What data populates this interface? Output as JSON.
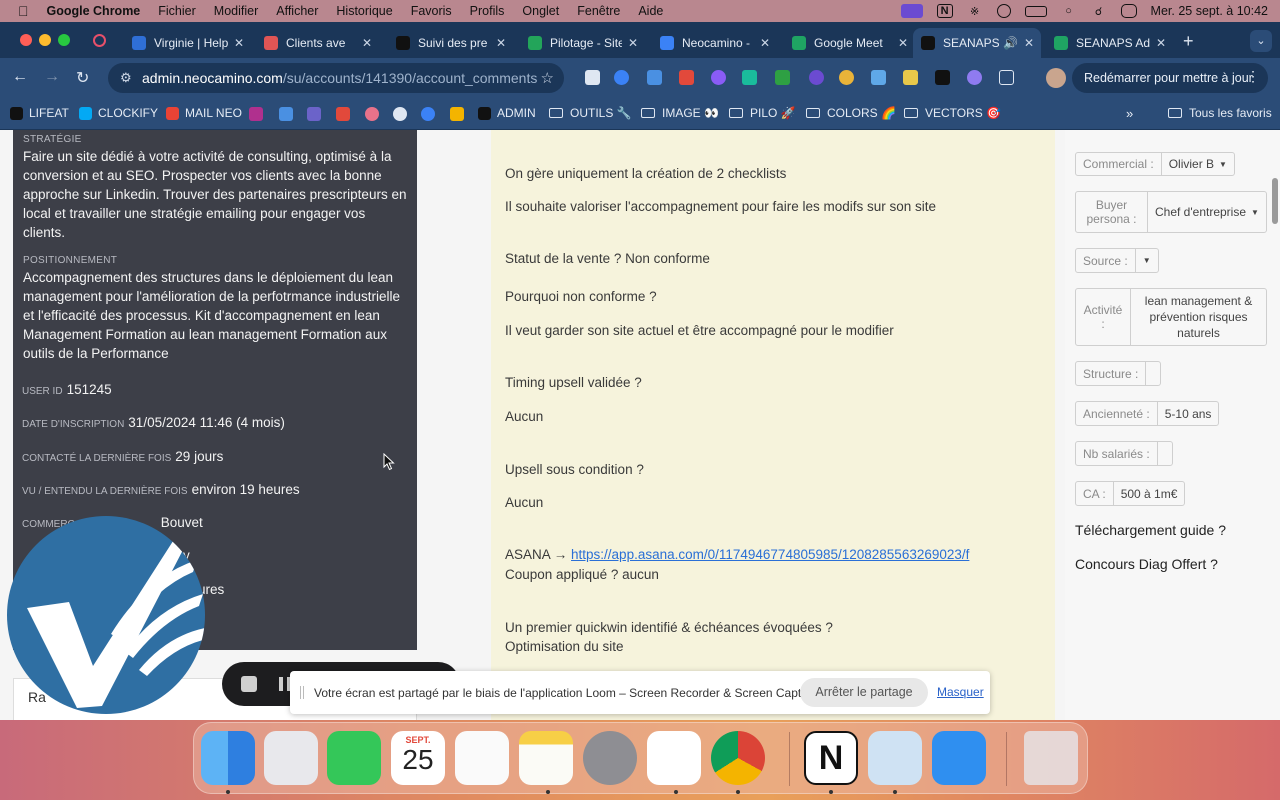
{
  "menubar": {
    "app_name": "Google Chrome",
    "items": [
      "Fichier",
      "Modifier",
      "Afficher",
      "Historique",
      "Favoris",
      "Profils",
      "Onglet",
      "Fenêtre",
      "Aide"
    ],
    "datetime": "Mer. 25 sept. à 10:42"
  },
  "tabs": [
    {
      "label": "Virginie | Help",
      "color": "#2f6fd6"
    },
    {
      "label": "Clients ave",
      "color": "#e05555"
    },
    {
      "label": "Suivi des pre",
      "color": "#111111"
    },
    {
      "label": "Pilotage - Site",
      "color": "#23a55a"
    },
    {
      "label": "Neocamino -",
      "color": "#3b82f6"
    },
    {
      "label": "Google Meet",
      "color": "#1fa463"
    },
    {
      "label": "SEANAPS",
      "color": "#111111"
    },
    {
      "label": "SEANAPS Ad",
      "color": "#1fa463"
    }
  ],
  "toolbar": {
    "url_host": "admin.neocamino.com",
    "url_path": "/su/accounts/141390/account_comments",
    "restart_label": "Redémarrer pour mettre à jour"
  },
  "bookmarks": [
    {
      "label": "LIFEAT",
      "type": "link",
      "color": "#111111"
    },
    {
      "label": "CLOCKIFY",
      "type": "link",
      "color": "#03a9f4"
    },
    {
      "label": "MAIL NEO",
      "type": "link",
      "color": "#ea4335"
    },
    {
      "label": "ADMIN",
      "type": "link",
      "color": "#111111"
    },
    {
      "label": "OUTILS 🔧",
      "type": "folder"
    },
    {
      "label": "IMAGE 👀",
      "type": "folder"
    },
    {
      "label": "PILO 🚀",
      "type": "folder"
    },
    {
      "label": "COLORS 🌈",
      "type": "folder"
    },
    {
      "label": "VECTORS 🎯",
      "type": "folder"
    },
    {
      "label": "Tous les favoris",
      "type": "folder"
    }
  ],
  "left_panel": {
    "strategie_label": "STRATÉGIE",
    "strategie_text": "Faire un site dédié à votre activité de consulting, optimisé à la conversion et au SEO. Prospecter vos clients avec la bonne approche sur Linkedin. Trouver des partenaires prescripteurs en local et travailler une stratégie emailing pour engager vos clients.",
    "positionnement_label": "POSITIONNEMENT",
    "positionnement_text": "Accompagnement des structures dans le déploiement du lean management pour l'amélioration de la perfotrmance industrielle et l'efficacité des processus. Kit d'accompagnement en lean Management Formation au lean management Formation aux outils de la Performance",
    "user_id_label": "USER ID",
    "user_id": "151245",
    "inscription_label": "DATE D'INSCRIPTION",
    "inscription_value": "31/05/2024 11:46 (4 mois)",
    "contacte_label": "CONTACTÉ LA DERNIÈRE FOIS",
    "contacte_value": "29 jours",
    "vu_label": "VU / ENTENDU LA DERNIÈRE FOIS",
    "vu_value": "environ 19 heures",
    "commercial_label_partial": "COMMERC",
    "commercial_value_partial": "Bouvet",
    "hidden_row_value_partial": "y",
    "hidden_row2_value_partial": "ures",
    "under_label_partial": "Ra"
  },
  "comments": {
    "lines": [
      "On gère uniquement la création de 2 checklists",
      "Il souhaite valoriser l'accompagnement pour faire les modifs sur son site",
      "Statut de la vente ? Non conforme",
      "Pourquoi non conforme ?",
      "Il veut garder son site actuel et être accompagné pour le modifier",
      "Timing upsell validée ?",
      "Aucun",
      "Upsell sous condition ?",
      "Aucun"
    ],
    "asana_prefix": "ASANA → ",
    "asana_link": "https://app.asana.com/0/1174946774805985/1208285563269023/f",
    "coupon": "Coupon appliqué ? aucun",
    "quickwin_q": "Un premier quickwin identifié & échéances évoquées ?",
    "quickwin_a": "Optimisation du site"
  },
  "right_fields": {
    "commercial_label": "Commercial :",
    "commercial_value": "Olivier B",
    "buyer_label": "Buyer persona :",
    "buyer_value": "Chef d'entreprise",
    "source_label": "Source :",
    "activite_label": "Activité :",
    "activite_value": "lean management & prévention risques naturels",
    "structure_label": "Structure :",
    "anciennete_label": "Ancienneté :",
    "anciennete_value": "5-10 ans",
    "salaries_label": "Nb salariés :",
    "ca_label": "CA :",
    "ca_value": "500 à 1m€",
    "guide_q": "Téléchargement guide ?",
    "diag_q": "Concours Diag Offert ?"
  },
  "share_bar": {
    "message": "Votre écran est partagé par le biais de l'application Loom – Screen Recorder & Screen Capture.",
    "stop_label": "Arrêter le partage",
    "hide_label": "Masquer"
  },
  "dock": {
    "calendar_month": "SEPT.",
    "calendar_day": "25",
    "apps": [
      "finder",
      "launchpad",
      "messages",
      "calendar",
      "reminders",
      "notes",
      "system-settings",
      "slack",
      "chrome",
      "notion",
      "preview",
      "mail",
      "trash"
    ]
  }
}
